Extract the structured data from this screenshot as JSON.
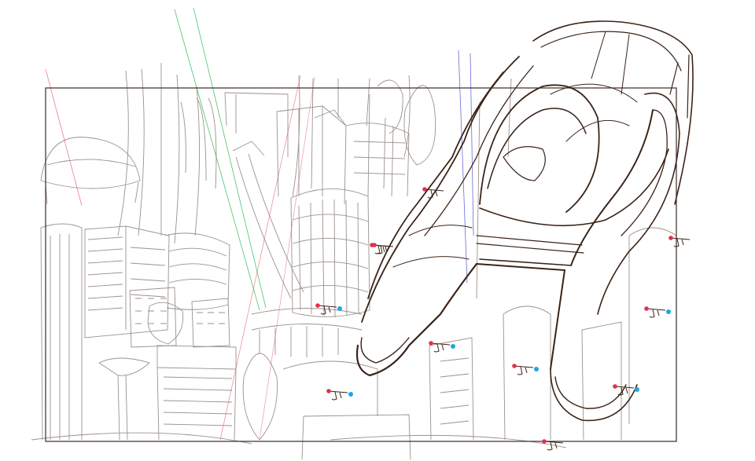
{
  "canvas": {
    "background": "#ffffff",
    "frame_color": "#3a2a24",
    "sketch_color": "#8a7f7a",
    "ink_color": "#3b2418",
    "guide_red": "#e04a5a",
    "guide_green": "#49c46a",
    "guide_blue": "#6a6ad8",
    "drone_red": "#e0304a",
    "drone_cyan": "#1aa9e0"
  },
  "drone_count": 11
}
